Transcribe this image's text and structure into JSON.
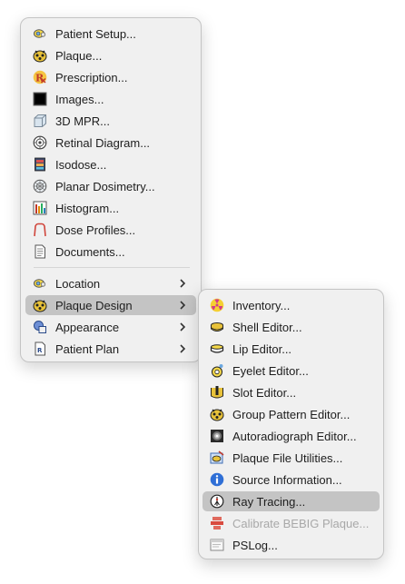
{
  "main_menu": {
    "items": [
      {
        "label": "Patient Setup...",
        "icon": "patient-setup-icon"
      },
      {
        "label": "Plaque...",
        "icon": "plaque-icon"
      },
      {
        "label": "Prescription...",
        "icon": "prescription-icon"
      },
      {
        "label": "Images...",
        "icon": "images-icon"
      },
      {
        "label": "3D MPR...",
        "icon": "3d-mpr-icon"
      },
      {
        "label": "Retinal Diagram...",
        "icon": "retinal-diagram-icon"
      },
      {
        "label": "Isodose...",
        "icon": "isodose-icon"
      },
      {
        "label": "Planar Dosimetry...",
        "icon": "planar-dosimetry-icon"
      },
      {
        "label": "Histogram...",
        "icon": "histogram-icon"
      },
      {
        "label": "Dose Profiles...",
        "icon": "dose-profiles-icon"
      },
      {
        "label": "Documents...",
        "icon": "documents-icon"
      }
    ],
    "submenus": [
      {
        "label": "Location",
        "icon": "location-icon"
      },
      {
        "label": "Plaque Design",
        "icon": "plaque-design-icon",
        "highlighted": true
      },
      {
        "label": "Appearance",
        "icon": "appearance-icon"
      },
      {
        "label": "Patient Plan",
        "icon": "patient-plan-icon"
      }
    ]
  },
  "plaque_design_menu": {
    "items": [
      {
        "label": "Inventory...",
        "icon": "inventory-icon"
      },
      {
        "label": "Shell Editor...",
        "icon": "shell-editor-icon"
      },
      {
        "label": "Lip Editor...",
        "icon": "lip-editor-icon"
      },
      {
        "label": "Eyelet Editor...",
        "icon": "eyelet-editor-icon"
      },
      {
        "label": "Slot Editor...",
        "icon": "slot-editor-icon"
      },
      {
        "label": "Group Pattern Editor...",
        "icon": "group-pattern-editor-icon"
      },
      {
        "label": "Autoradiograph Editor...",
        "icon": "autoradiograph-editor-icon"
      },
      {
        "label": "Plaque File Utilities...",
        "icon": "plaque-file-utilities-icon"
      },
      {
        "label": "Source Information...",
        "icon": "info-icon"
      },
      {
        "label": "Ray Tracing...",
        "icon": "ray-tracing-icon",
        "highlighted": true
      },
      {
        "label": "Calibrate BEBIG Plaque...",
        "icon": "calibrate-icon",
        "disabled": true
      },
      {
        "label": "PSLog...",
        "icon": "pslog-icon"
      }
    ]
  },
  "colors": {
    "menu_bg": "#f0f0f0",
    "highlight": "#c4c4c4",
    "disabled_text": "#a8a8a8"
  }
}
